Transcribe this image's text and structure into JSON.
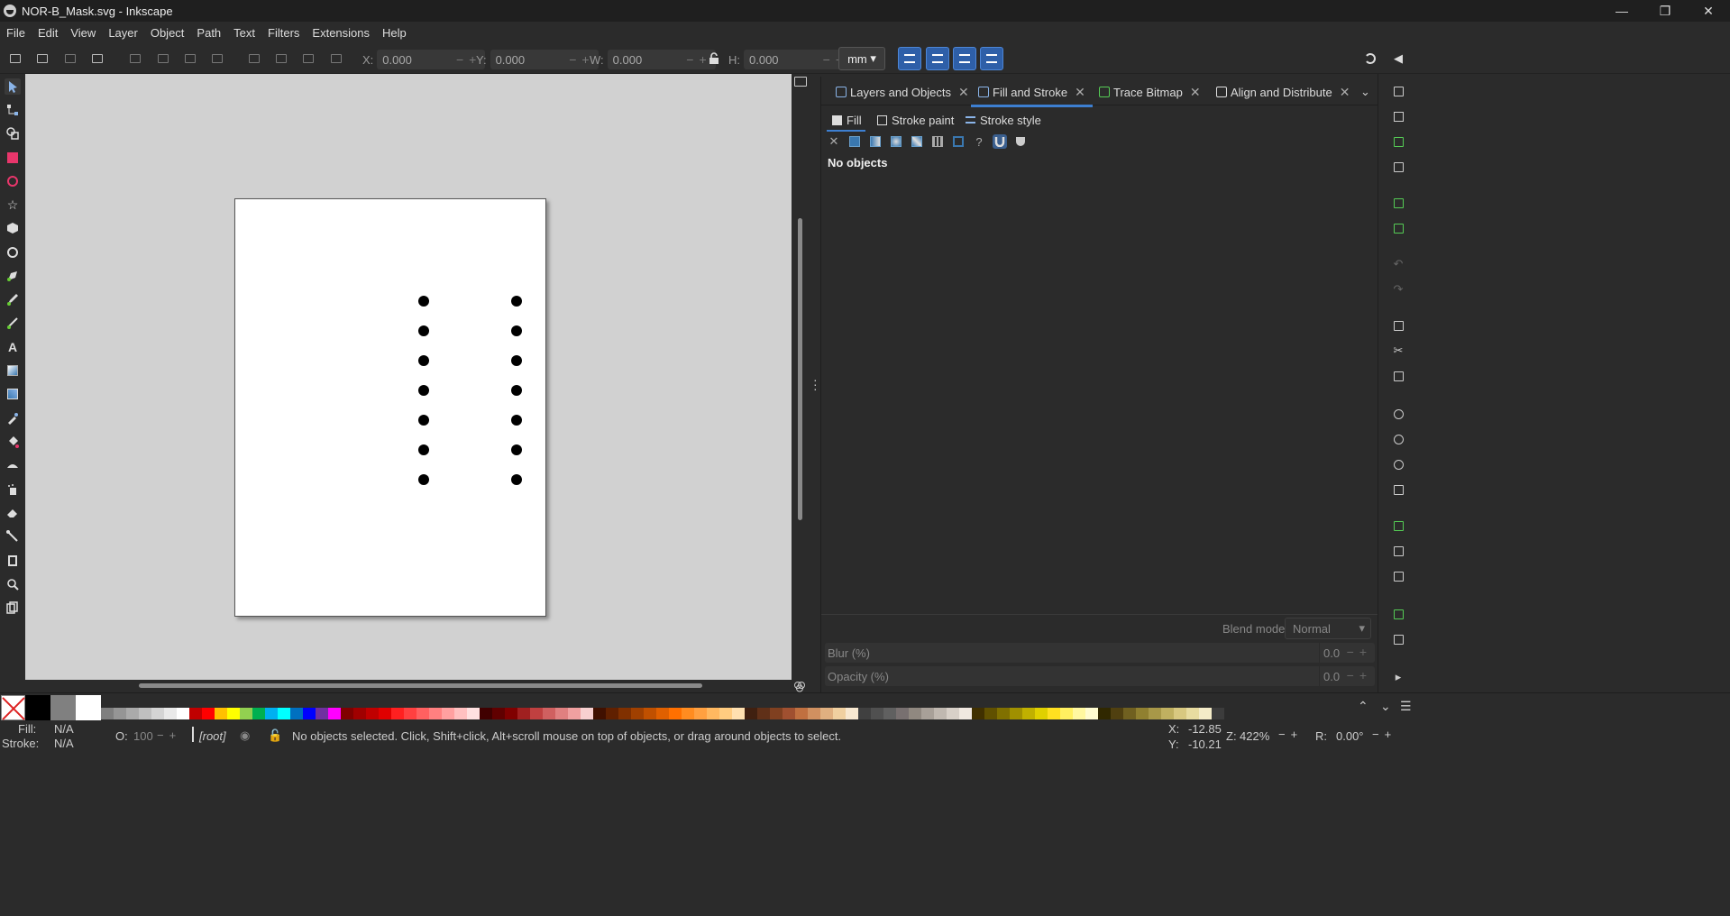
{
  "window": {
    "title": "NOR-B_Mask.svg - Inkscape",
    "minimize_icon": "minimize-icon",
    "maximize_icon": "restore-icon",
    "close_icon": "close-icon"
  },
  "menu": [
    "File",
    "Edit",
    "View",
    "Layer",
    "Object",
    "Path",
    "Text",
    "Filters",
    "Extensions",
    "Help"
  ],
  "toolbar": {
    "x_label": "X:",
    "x_value": "0.000",
    "y_label": "Y:",
    "y_value": "0.000",
    "w_label": "W:",
    "w_value": "0.000",
    "h_label": "H:",
    "h_value": "0.000",
    "unit": "mm",
    "lock_icon": "lock-icon"
  },
  "dock": {
    "tabs": [
      {
        "label": "Layers and Objects",
        "icon": "layers-icon"
      },
      {
        "label": "Fill and Stroke",
        "icon": "fill-stroke-icon"
      },
      {
        "label": "Trace Bitmap",
        "icon": "trace-bitmap-icon"
      },
      {
        "label": "Align and Distribute",
        "icon": "align-icon"
      }
    ],
    "subtabs": [
      {
        "label": "Fill",
        "icon": "fill-icon"
      },
      {
        "label": "Stroke paint",
        "icon": "stroke-paint-icon"
      },
      {
        "label": "Stroke style",
        "icon": "stroke-style-icon"
      }
    ],
    "paint_types": [
      "no-paint-icon",
      "flat-color-icon",
      "linear-gradient-icon",
      "radial-gradient-icon",
      "mesh-gradient-icon",
      "pattern-icon",
      "swatch-icon",
      "unset-paint-icon",
      "fill-rule-evenodd-icon",
      "fill-rule-nonzero-icon"
    ],
    "message": "No objects",
    "blend_mode_label": "Blend mode:",
    "blend_mode_value": "Normal",
    "blur_label": "Blur (%)",
    "blur_value": "0.0",
    "opacity_label": "Opacity (%)",
    "opacity_value": "0.0"
  },
  "colors": {
    "accent": "#3d7fd1",
    "canvas": "#d1d1d1",
    "page": "#ffffff",
    "ui_bg": "#2b2b2b"
  },
  "palette": [
    "#7f7f7f",
    "#959595",
    "#aaaaaa",
    "#bfbfbf",
    "#d4d4d4",
    "#e9e9e9",
    "#ffffff",
    "#c00000",
    "#ff0000",
    "#ffc000",
    "#ffff00",
    "#92d050",
    "#00b050",
    "#00b0f0",
    "#00ffff",
    "#0070c0",
    "#0000ff",
    "#7030a0",
    "#ff00ff",
    "#800000",
    "#a00000",
    "#c00000",
    "#e00000",
    "#ff2020",
    "#ff4040",
    "#ff6060",
    "#ff8080",
    "#ffa0a0",
    "#ffc0c0",
    "#ffe0e0",
    "#400000",
    "#600000",
    "#800000",
    "#a02020",
    "#c04040",
    "#d06060",
    "#e08080",
    "#f0a0a0",
    "#f8d0d0",
    "#401000",
    "#602000",
    "#803000",
    "#a04000",
    "#c05000",
    "#e06000",
    "#ff7000",
    "#ff8c20",
    "#ffa040",
    "#ffb860",
    "#ffcc80",
    "#ffe0b0",
    "#402010",
    "#603018",
    "#804020",
    "#a05030",
    "#c07040",
    "#d09060",
    "#e0b080",
    "#f0d0a0",
    "#f8e8d0",
    "#404040",
    "#505050",
    "#606060",
    "#787070",
    "#908880",
    "#a8a098",
    "#c0b8b0",
    "#d8d0c8",
    "#f0e8e0",
    "#403000",
    "#605000",
    "#807000",
    "#a09000",
    "#c0b000",
    "#e0d000",
    "#ffe020",
    "#fff060",
    "#fff8a0",
    "#fffcd0",
    "#302800",
    "#504010",
    "#706020",
    "#908030",
    "#a89848",
    "#c0b060",
    "#d8c880",
    "#e8dca0",
    "#f4ecc8",
    "#3c3c3c"
  ],
  "status": {
    "fill_label": "Fill:",
    "fill_value": "N/A",
    "stroke_label": "Stroke:",
    "stroke_value": "N/A",
    "opacity_label": "O:",
    "opacity_value": "100",
    "layer": "[root]",
    "message": "No objects selected. Click, Shift+click, Alt+scroll mouse on top of objects, or drag around objects to select.",
    "x_label": "X:",
    "x_value": "-12.85",
    "y_label": "Y:",
    "y_value": "-10.21",
    "zoom_label": "Z:",
    "zoom_value": "422%",
    "rotation_label": "R:",
    "rotation_value": "0.00°"
  }
}
